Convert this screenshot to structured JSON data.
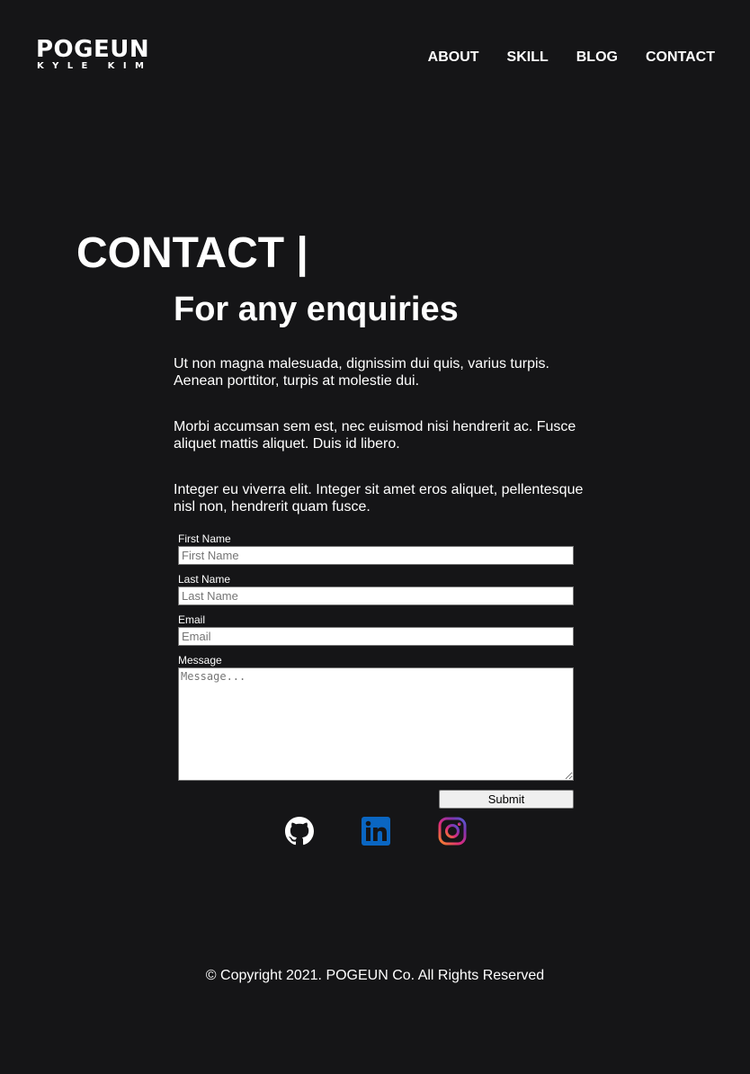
{
  "header": {
    "logo_title": "POGEUN",
    "logo_subtitle": "KYLE KIM",
    "nav": [
      {
        "label": "ABOUT"
      },
      {
        "label": "SKILL"
      },
      {
        "label": "BLOG"
      },
      {
        "label": "CONTACT"
      }
    ]
  },
  "page": {
    "title": "CONTACT |"
  },
  "content": {
    "heading": "For any enquiries",
    "paragraphs": [
      "Ut non magna malesuada, dignissim dui quis, varius turpis. Aenean porttitor, turpis at molestie dui.",
      "Morbi accumsan sem est, nec euismod nisi hendrerit ac. Fusce aliquet mattis aliquet. Duis id libero.",
      "Integer eu viverra elit. Integer sit amet eros aliquet, pellentesque nisl non, hendrerit quam fusce."
    ]
  },
  "form": {
    "first_name": {
      "label": "First Name",
      "placeholder": "First Name",
      "value": ""
    },
    "last_name": {
      "label": "Last Name",
      "placeholder": "Last Name",
      "value": ""
    },
    "email": {
      "label": "Email",
      "placeholder": "Email",
      "value": ""
    },
    "message": {
      "label": "Message",
      "placeholder": "Message...",
      "value": ""
    },
    "submit_label": "Submit"
  },
  "social": [
    {
      "icon": "github-icon"
    },
    {
      "icon": "linkedin-icon"
    },
    {
      "icon": "instagram-icon"
    }
  ],
  "colors": {
    "background": "#151517",
    "text": "#ffffff",
    "linkedin": "#0a66c2",
    "instagram_gradient": [
      "#f58529",
      "#dd2a7b",
      "#8134af",
      "#515bd4"
    ]
  },
  "footer": {
    "copyright": "© Copyright 2021. POGEUN Co. All Rights Reserved"
  }
}
